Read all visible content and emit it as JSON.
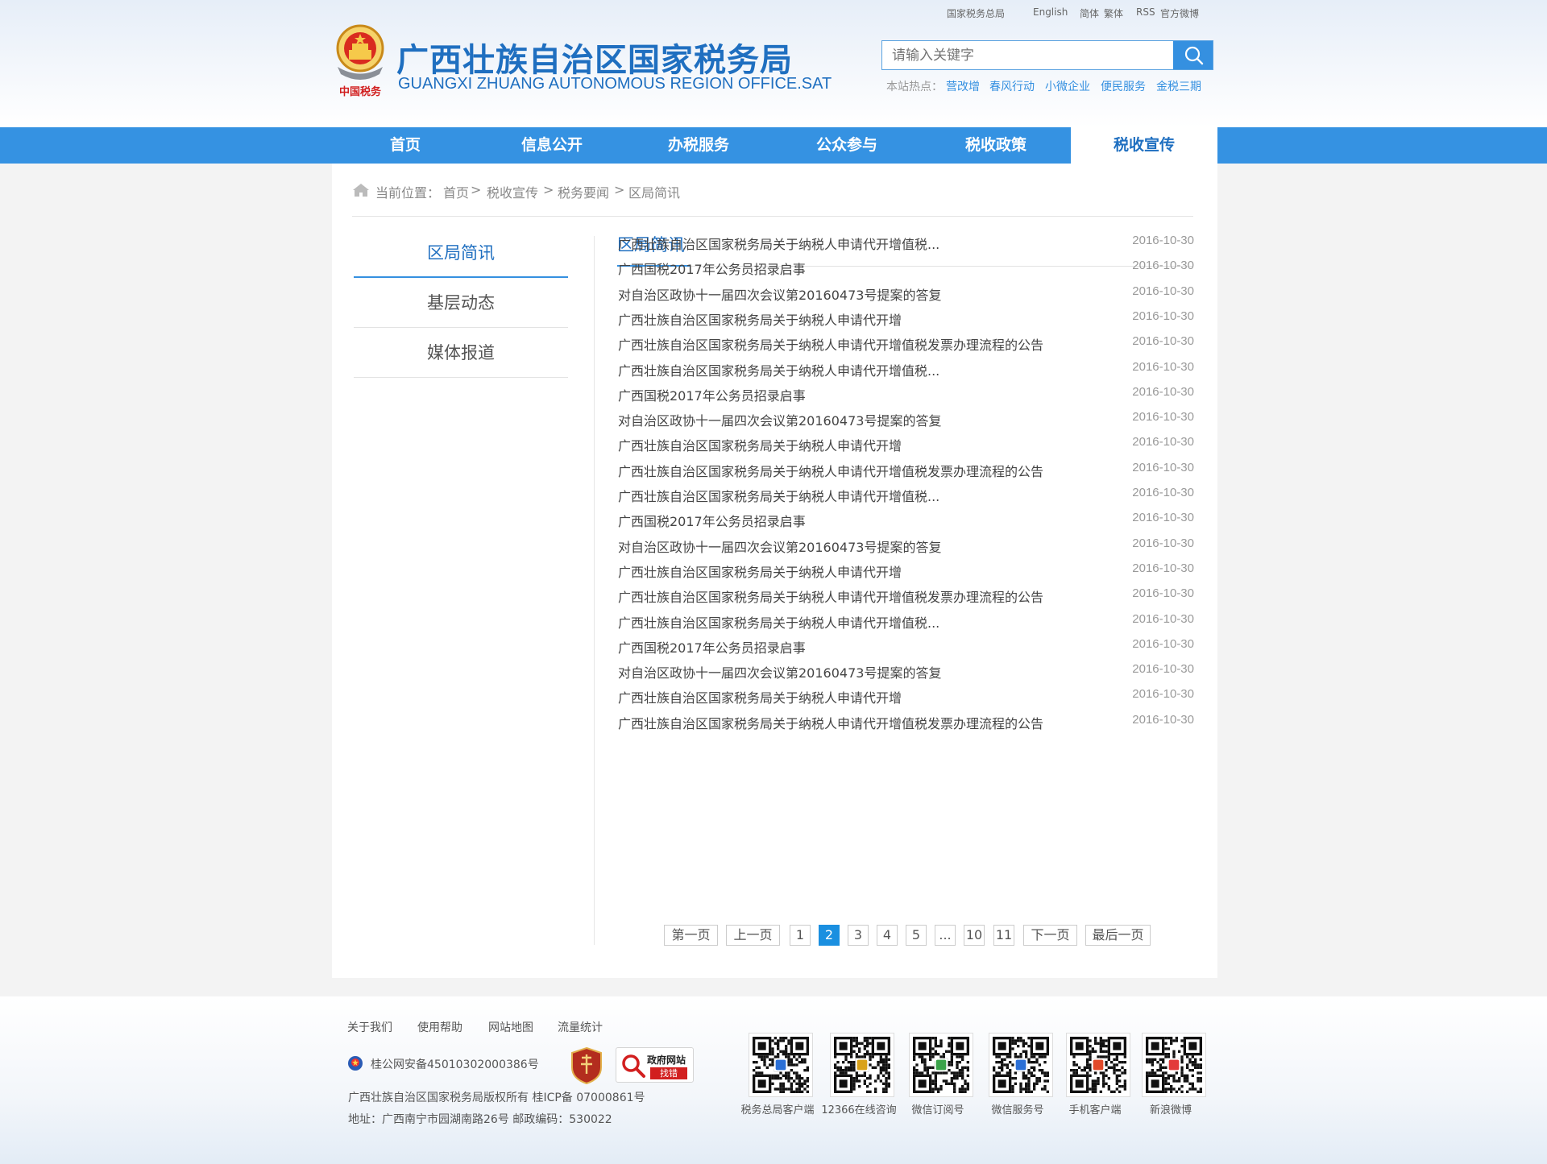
{
  "header": {
    "title": "广西壮族自治区国家税务局",
    "subtitle": "GUANGXI ZHUANG AUTONOMOUS REGION OFFICE.SAT",
    "emblem_caption": "中国税务",
    "toplinks": [
      "国家税务总局",
      "English",
      "简体",
      "繁体",
      "RSS",
      "官方微博"
    ],
    "search_placeholder": "请输入关键字",
    "hot_label": "本站热点：",
    "hot_links": [
      "营改增",
      "春风行动",
      "小微企业",
      "便民服务",
      "金税三期"
    ]
  },
  "nav": {
    "items": [
      "首页",
      "信息公开",
      "办税服务",
      "公众参与",
      "税收政策",
      "税收宣传"
    ],
    "active_index": 5
  },
  "breadcrumb": {
    "label": "当前位置：",
    "items": [
      "首页",
      "税收宣传",
      "税务要闻",
      "区局简讯"
    ],
    "separator": ">"
  },
  "sidebar": {
    "items": [
      "区局简讯",
      "基层动态",
      "媒体报道"
    ],
    "active_index": 0
  },
  "list": {
    "title": "区局简讯",
    "articles": [
      {
        "title": "广西壮族自治区国家税务局关于纳税人申请代开增值税...",
        "date": "2016-10-30"
      },
      {
        "title": "广西国税2017年公务员招录启事",
        "date": "2016-10-30"
      },
      {
        "title": "对自治区政协十一届四次会议第20160473号提案的答复",
        "date": "2016-10-30"
      },
      {
        "title": "广西壮族自治区国家税务局关于纳税人申请代开增",
        "date": "2016-10-30"
      },
      {
        "title": "广西壮族自治区国家税务局关于纳税人申请代开增值税发票办理流程的公告",
        "date": "2016-10-30"
      },
      {
        "title": "广西壮族自治区国家税务局关于纳税人申请代开增值税...",
        "date": "2016-10-30"
      },
      {
        "title": "广西国税2017年公务员招录启事",
        "date": "2016-10-30"
      },
      {
        "title": "对自治区政协十一届四次会议第20160473号提案的答复",
        "date": "2016-10-30"
      },
      {
        "title": "广西壮族自治区国家税务局关于纳税人申请代开增",
        "date": "2016-10-30"
      },
      {
        "title": "广西壮族自治区国家税务局关于纳税人申请代开增值税发票办理流程的公告",
        "date": "2016-10-30"
      },
      {
        "title": "广西壮族自治区国家税务局关于纳税人申请代开增值税...",
        "date": "2016-10-30"
      },
      {
        "title": "广西国税2017年公务员招录启事",
        "date": "2016-10-30"
      },
      {
        "title": "对自治区政协十一届四次会议第20160473号提案的答复",
        "date": "2016-10-30"
      },
      {
        "title": "广西壮族自治区国家税务局关于纳税人申请代开增",
        "date": "2016-10-30"
      },
      {
        "title": "广西壮族自治区国家税务局关于纳税人申请代开增值税发票办理流程的公告",
        "date": "2016-10-30"
      },
      {
        "title": "广西壮族自治区国家税务局关于纳税人申请代开增值税...",
        "date": "2016-10-30"
      },
      {
        "title": "广西国税2017年公务员招录启事",
        "date": "2016-10-30"
      },
      {
        "title": "对自治区政协十一届四次会议第20160473号提案的答复",
        "date": "2016-10-30"
      },
      {
        "title": "广西壮族自治区国家税务局关于纳税人申请代开增",
        "date": "2016-10-30"
      },
      {
        "title": "广西壮族自治区国家税务局关于纳税人申请代开增值税发票办理流程的公告",
        "date": "2016-10-30"
      }
    ]
  },
  "pagination": {
    "first": "第一页",
    "prev": "上一页",
    "pages": [
      "1",
      "2",
      "3",
      "4",
      "5",
      "...",
      "10",
      "11"
    ],
    "current": "2",
    "next": "下一页",
    "last": "最后一页"
  },
  "footer": {
    "links": [
      "关于我们",
      "使用帮助",
      "网站地图",
      "流量统计"
    ],
    "police_record": "桂公网安备45010302000386号",
    "copyright": "广西壮族自治区国家税务局版权所有 桂ICP备 07000861号",
    "address": "地址：广西南宁市园湖南路26号 邮政编码：530022",
    "gov_badge": [
      "政府网站",
      "找错"
    ],
    "qrcodes": [
      "税务总局客户端",
      "12366在线咨询",
      "微信订阅号",
      "微信服务号",
      "手机客户端",
      "新浪微博"
    ]
  },
  "colors": {
    "brand_blue": "#1f6fc0",
    "nav_blue": "#3592e2",
    "pager_active": "#1a8fe0"
  }
}
